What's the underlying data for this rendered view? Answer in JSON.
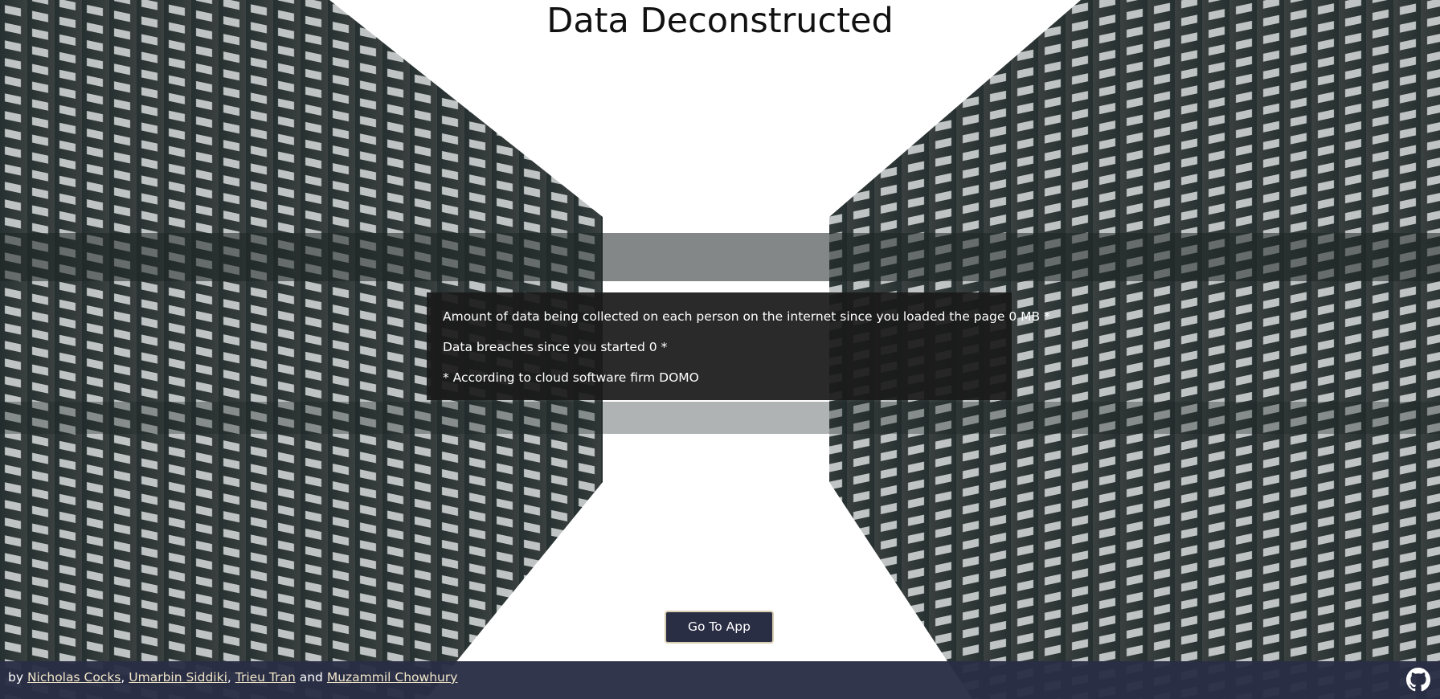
{
  "page": {
    "title": "Data Deconstructed"
  },
  "stats": {
    "data_collected_label": "Amount of data being collected on each person on the internet since you loaded the page",
    "data_collected_value": "0 MB",
    "data_collected_marker": "*",
    "breaches_label": "Data breaches since you started",
    "breaches_value": "0",
    "breaches_marker": "*",
    "source_note": "* According to cloud software firm DOMO"
  },
  "cta": {
    "label": "Go To App"
  },
  "footer": {
    "prefix": "by",
    "authors": [
      "Nicholas Cocks",
      "Umarbin Siddiki",
      "Trieu Tran",
      "Muzammil Chowhury"
    ],
    "separator": ",",
    "conjunction": "and",
    "github_icon": "github-icon"
  },
  "colors": {
    "panel_bg": "#1a1a1a",
    "button_bg": "#2a2e45",
    "button_border": "#d8cdb0",
    "footer_bg": "#2a2e46",
    "link_color": "#f0e6c8",
    "facade": "#2b302f"
  }
}
